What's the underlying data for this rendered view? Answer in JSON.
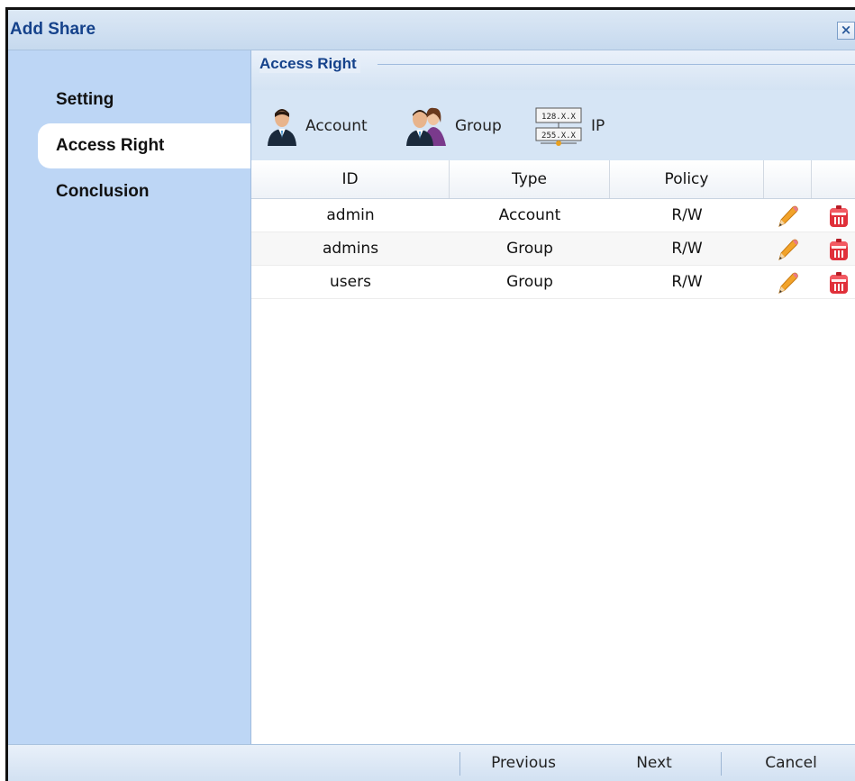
{
  "dialog": {
    "title": "Add Share",
    "close_label": "×"
  },
  "sidebar": {
    "items": [
      {
        "label": "Setting",
        "active": false
      },
      {
        "label": "Access Right",
        "active": true
      },
      {
        "label": "Conclusion",
        "active": false
      }
    ]
  },
  "section": {
    "title": "Access Right"
  },
  "toolbar": {
    "account": {
      "label": "Account",
      "icon": "account-icon"
    },
    "group": {
      "label": "Group",
      "icon": "group-icon"
    },
    "ip": {
      "label": "IP",
      "icon": "ip-icon",
      "icon_text_top": "128.X.X",
      "icon_text_bottom": "255.X.X"
    }
  },
  "table": {
    "columns": [
      "ID",
      "Type",
      "Policy",
      "",
      ""
    ],
    "rows": [
      {
        "id": "admin",
        "type": "Account",
        "policy": "R/W"
      },
      {
        "id": "admins",
        "type": "Group",
        "policy": "R/W"
      },
      {
        "id": "users",
        "type": "Group",
        "policy": "R/W"
      }
    ]
  },
  "footer": {
    "previous": "Previous",
    "next": "Next",
    "cancel": "Cancel"
  },
  "colors": {
    "sidebar": "#bdd6f5",
    "title": "#15428b",
    "toolbar": "#d6e5f5"
  }
}
